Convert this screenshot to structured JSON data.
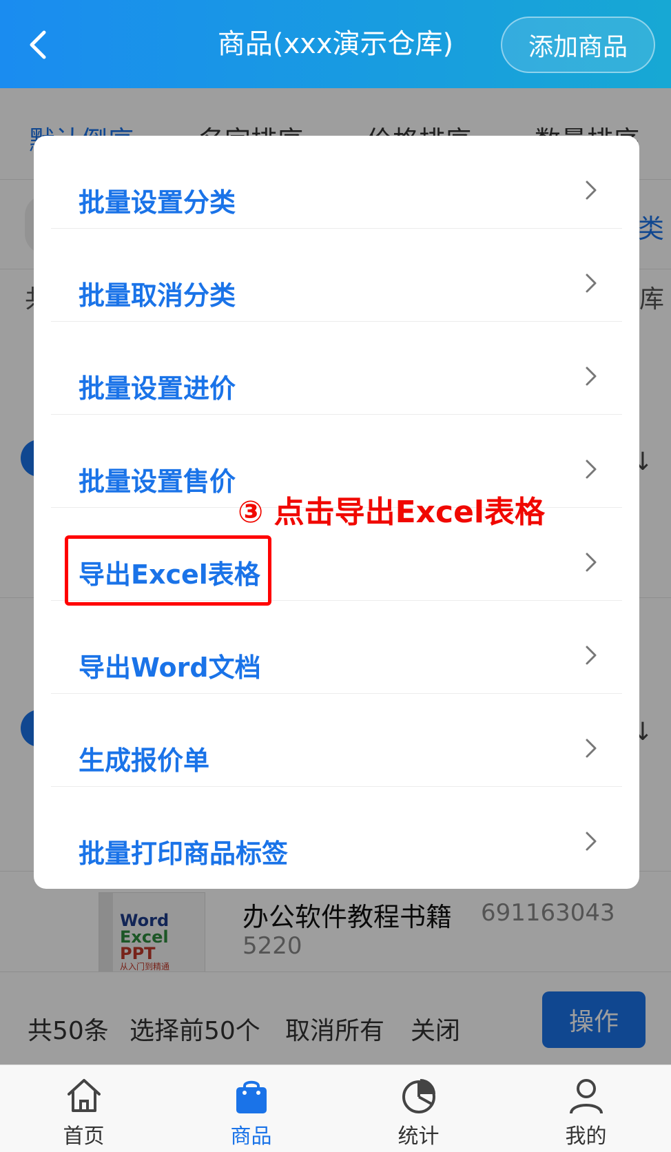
{
  "header": {
    "title": "商品(xxx演示仓库)",
    "add_button": "添加商品"
  },
  "background": {
    "sort_tabs": [
      "默认倒序",
      "名字排序",
      "价格排序",
      "数量排序"
    ],
    "row2_right": "类",
    "row3_left": "共",
    "row3_right": "库",
    "product": {
      "name": "办公软件教程书籍",
      "code_line1": "691163043",
      "code_line2": "5220",
      "book_cover": {
        "line1": "Word",
        "line2": "Excel",
        "line3": "PPT",
        "line4": "从入门到精通"
      }
    },
    "bottom_bar": {
      "count": "共50条",
      "select_first": "选择前50个",
      "cancel_all": "取消所有",
      "close": "关闭",
      "operate": "操作"
    }
  },
  "menu": {
    "items": [
      {
        "label": "批量设置分类"
      },
      {
        "label": "批量取消分类"
      },
      {
        "label": "批量设置进价"
      },
      {
        "label": "批量设置售价"
      },
      {
        "label": "导出Excel表格"
      },
      {
        "label": "导出Word文档"
      },
      {
        "label": "生成报价单"
      },
      {
        "label": "批量打印商品标签"
      }
    ]
  },
  "annotation": {
    "text": "③ 点击导出Excel表格",
    "color": "#f00800"
  },
  "tabbar": {
    "tabs": [
      {
        "label": "首页",
        "icon": "home-icon"
      },
      {
        "label": "商品",
        "icon": "shopping-bag-icon"
      },
      {
        "label": "统计",
        "icon": "pie-chart-icon"
      },
      {
        "label": "我的",
        "icon": "user-icon"
      }
    ],
    "active": "商品"
  },
  "colors": {
    "accent": "#1a73e8",
    "header_gradient_start": "#1a8cf0",
    "header_gradient_end": "#17a8d4",
    "highlight_border": "#ff0000"
  }
}
